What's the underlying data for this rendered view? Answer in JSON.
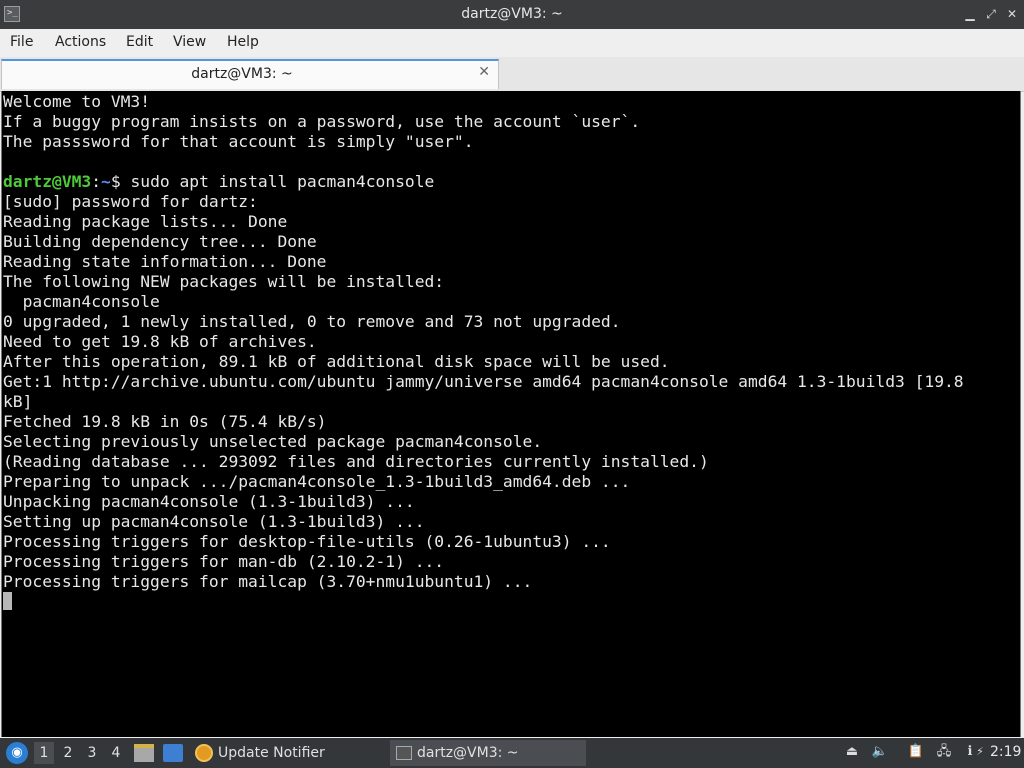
{
  "window": {
    "title": "dartz@VM3: ~",
    "title_icon": "terminal-icon",
    "buttons": {
      "minimize": "▁",
      "maximize": "⤢",
      "close": "✕"
    }
  },
  "menu": {
    "items": [
      "File",
      "Actions",
      "Edit",
      "View",
      "Help"
    ]
  },
  "tab": {
    "label": "dartz@VM3: ~",
    "close": "✕"
  },
  "terminal": {
    "colors": {
      "background": "#000000",
      "text": "#e8e8e8",
      "user": "#4ec93a",
      "path": "#5b8def"
    },
    "welcome_lines": [
      "Welcome to VM3!",
      "If a buggy program insists on a password, use the account `user`.",
      "The passsword for that account is simply \"user\".",
      ""
    ],
    "prompt": {
      "user": "dartz@VM3",
      "sep": ":",
      "path": "~",
      "symbol": "$",
      "command": " sudo apt install pacman4console"
    },
    "output_lines": [
      "[sudo] password for dartz:",
      "Reading package lists... Done",
      "Building dependency tree... Done",
      "Reading state information... Done",
      "The following NEW packages will be installed:",
      "  pacman4console",
      "0 upgraded, 1 newly installed, 0 to remove and 73 not upgraded.",
      "Need to get 19.8 kB of archives.",
      "After this operation, 89.1 kB of additional disk space will be used.",
      "Get:1 http://archive.ubuntu.com/ubuntu jammy/universe amd64 pacman4console amd64 1.3-1build3 [19.8",
      "kB]",
      "Fetched 19.8 kB in 0s (75.4 kB/s)",
      "Selecting previously unselected package pacman4console.",
      "(Reading database ... 293092 files and directories currently installed.)",
      "Preparing to unpack .../pacman4console_1.3-1build3_amd64.deb ...",
      "Unpacking pacman4console (1.3-1build3) ...",
      "Setting up pacman4console (1.3-1build3) ...",
      "Processing triggers for desktop-file-utils (0.26-1ubuntu3) ...",
      "Processing triggers for man-db (2.10.2-1) ...",
      "Processing triggers for mailcap (3.70+nmu1ubuntu1) ..."
    ]
  },
  "taskbar": {
    "start_icon": "lubuntu-logo-icon",
    "desktops": [
      "1",
      "2",
      "3",
      "4"
    ],
    "active_desktop": "1",
    "quick_launch": [
      "file-manager-icon",
      "show-desktop-icon"
    ],
    "tasks": [
      {
        "label": "Update Notifier",
        "icon": "update-notifier-icon"
      },
      {
        "label": "dartz@VM3: ~",
        "icon": "terminal-icon"
      }
    ],
    "tray_icons": [
      "eject-icon",
      "volume-icon",
      "clipboard-icon",
      "network-icon",
      "notification-icon",
      "power-icon"
    ],
    "clock": "2:19"
  }
}
